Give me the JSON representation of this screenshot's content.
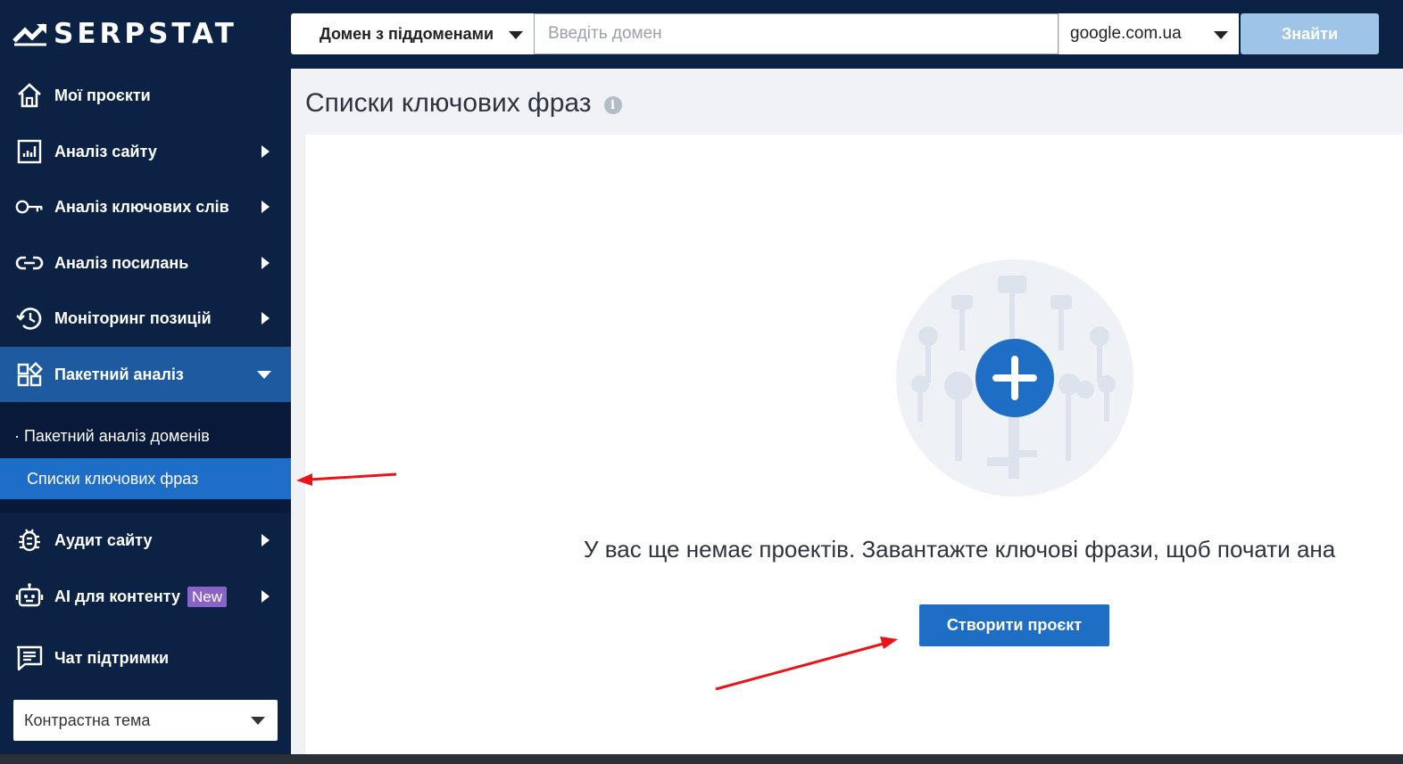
{
  "brand": {
    "name": "SERPSTAT"
  },
  "sidebar": {
    "items": [
      {
        "label": "Мої проєкти",
        "icon": "home-icon"
      },
      {
        "label": "Аналіз сайту",
        "icon": "site-analysis-icon"
      },
      {
        "label": "Аналіз ключових слів",
        "icon": "key-icon"
      },
      {
        "label": "Аналіз посилань",
        "icon": "link-icon"
      },
      {
        "label": "Моніторинг позицій",
        "icon": "history-icon"
      },
      {
        "label": "Пакетний аналіз",
        "icon": "batch-grid-icon"
      }
    ],
    "batch_sub": [
      {
        "label": "· Пакетний аналіз доменів"
      },
      {
        "label": "Списки ключових фраз"
      }
    ],
    "items_after": [
      {
        "label": "Аудит сайту",
        "icon": "bug-icon"
      },
      {
        "label": "AI для контенту",
        "icon": "robot-icon",
        "badge": "New"
      },
      {
        "label": "Чат підтримки",
        "icon": "chat-icon"
      }
    ],
    "theme_select": "Контрастна тема"
  },
  "topbar": {
    "search_type": "Домен з піддоменами",
    "domain_placeholder": "Введіть домен",
    "engine": "google.com.ua",
    "find_label": "Знайти"
  },
  "main": {
    "title": "Списки ключових фраз",
    "info_glyph": "i",
    "empty_message": "У вас ще немає проектів. Завантажте ключові фрази, щоб почати ана",
    "create_label": "Створити проєкт"
  },
  "colors": {
    "sidebar_bg": "#0c2245",
    "active_bg": "#1e5aa0",
    "selected_sub_bg": "#1e6ec8",
    "accent": "#1f6ec6",
    "new_badge": "#8a63c9",
    "annotation_arrow": "#e8141a"
  }
}
